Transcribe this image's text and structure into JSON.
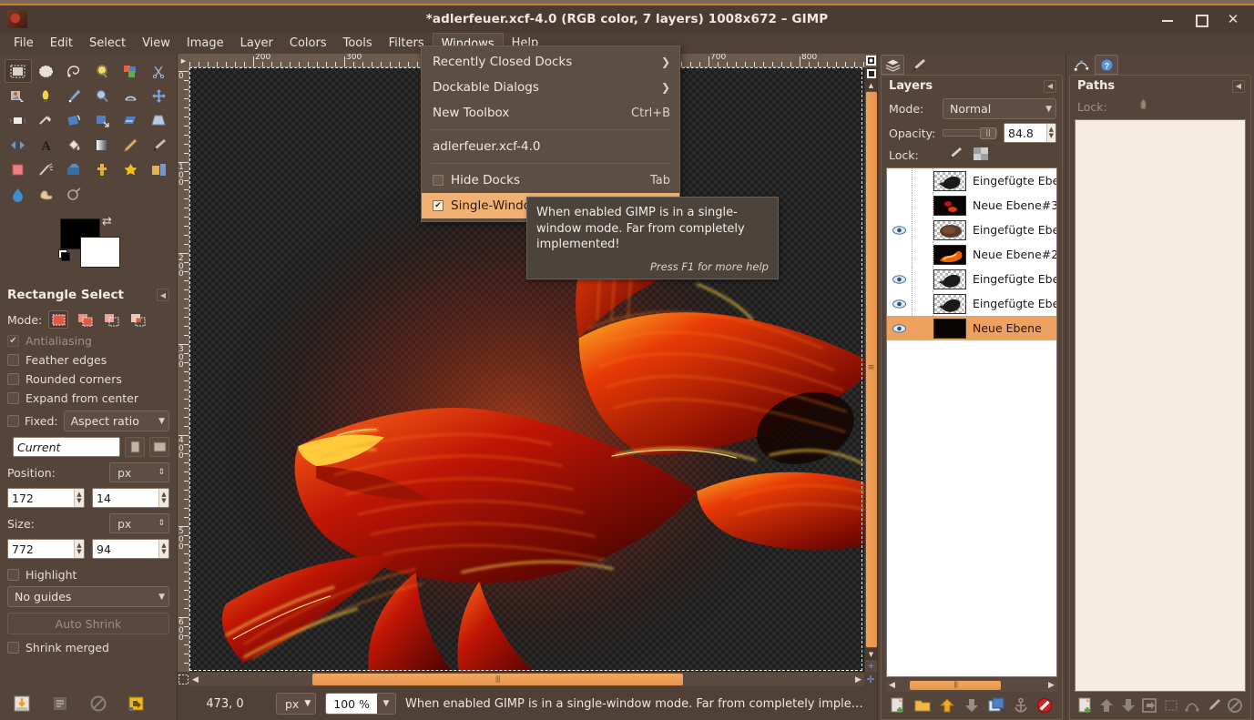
{
  "window": {
    "title": "*adlerfeuer.xcf-4.0 (RGB color, 7 layers) 1008x672 – GIMP",
    "app_icon": "gimp-wilber-icon",
    "minimize": "–",
    "maximize": "□",
    "close": "✕"
  },
  "menubar": [
    {
      "label": "File",
      "name": "menu-file"
    },
    {
      "label": "Edit",
      "name": "menu-edit"
    },
    {
      "label": "Select",
      "name": "menu-select"
    },
    {
      "label": "View",
      "name": "menu-view"
    },
    {
      "label": "Image",
      "name": "menu-image"
    },
    {
      "label": "Layer",
      "name": "menu-layer"
    },
    {
      "label": "Colors",
      "name": "menu-colors"
    },
    {
      "label": "Tools",
      "name": "menu-tools"
    },
    {
      "label": "Filters",
      "name": "menu-filters"
    },
    {
      "label": "Windows",
      "name": "menu-windows",
      "active": true
    },
    {
      "label": "Help",
      "name": "menu-help"
    }
  ],
  "windows_menu": {
    "items": [
      {
        "label": "Recently Closed Docks",
        "accel": "",
        "submenu": true,
        "type": "submenu"
      },
      {
        "label": "Dockable Dialogs",
        "accel": "",
        "submenu": true,
        "type": "submenu"
      },
      {
        "label": "New Toolbox",
        "accel": "Ctrl+B",
        "type": "normal"
      },
      {
        "type": "separator"
      },
      {
        "label": "adlerfeuer.xcf-4.0",
        "accel": "",
        "type": "normal"
      },
      {
        "type": "separator"
      },
      {
        "label": "Hide Docks",
        "accel": "Tab",
        "type": "check",
        "checked": false
      },
      {
        "label": "Single-Window Mode",
        "accel": "",
        "type": "check",
        "checked": true,
        "highlighted": true
      }
    ]
  },
  "tooltip": {
    "text": "When enabled GIMP is in a single-window mode. Far from completely implemented!",
    "help": "Press F1 for more help"
  },
  "toolbox": {
    "tools": [
      {
        "name": "rectangle-select-tool",
        "selected": true
      },
      {
        "name": "ellipse-select-tool"
      },
      {
        "name": "free-select-tool"
      },
      {
        "name": "fuzzy-select-tool"
      },
      {
        "name": "select-by-color-tool"
      },
      {
        "name": "scissors-select-tool"
      },
      {
        "name": "foreground-select-tool"
      },
      {
        "name": "paths-tool"
      },
      {
        "name": "color-picker-tool"
      },
      {
        "name": "zoom-tool"
      },
      {
        "name": "measure-tool"
      },
      {
        "name": "move-tool"
      },
      {
        "name": "alignment-tool"
      },
      {
        "name": "crop-tool"
      },
      {
        "name": "rotate-tool"
      },
      {
        "name": "scale-tool"
      },
      {
        "name": "shear-tool"
      },
      {
        "name": "perspective-tool"
      },
      {
        "name": "flip-tool"
      },
      {
        "name": "text-tool"
      },
      {
        "name": "bucket-fill-tool"
      },
      {
        "name": "blend-gradient-tool"
      },
      {
        "name": "pencil-tool"
      },
      {
        "name": "paintbrush-tool"
      },
      {
        "name": "eraser-tool"
      },
      {
        "name": "airbrush-tool"
      },
      {
        "name": "ink-tool"
      },
      {
        "name": "clone-tool"
      },
      {
        "name": "heal-tool"
      },
      {
        "name": "perspective-clone-tool"
      },
      {
        "name": "blur-sharpen-tool"
      },
      {
        "name": "smudge-tool"
      },
      {
        "name": "dodge-burn-tool"
      }
    ],
    "colors": {
      "foreground": "#000000",
      "background": "#ffffff"
    }
  },
  "tool_options": {
    "title": "Rectangle Select",
    "mode_label": "Mode:",
    "modes": [
      "replace",
      "add",
      "subtract",
      "intersect"
    ],
    "mode_selected": 0,
    "checkboxes": [
      {
        "label": "Antialiasing",
        "checked": true,
        "disabled": true
      },
      {
        "label": "Feather edges",
        "checked": false,
        "disabled": false
      },
      {
        "label": "Rounded corners",
        "checked": false,
        "disabled": false
      },
      {
        "label": "Expand from center",
        "checked": false,
        "disabled": false
      }
    ],
    "fixed_label": "Fixed:",
    "fixed_checked": false,
    "fixed_value": "Aspect ratio",
    "aspect_value": "Current",
    "position_label": "Position:",
    "position_unit": "px",
    "position_x": "172",
    "position_y": "14",
    "size_label": "Size:",
    "size_unit": "px",
    "size_w": "772",
    "size_h": "94",
    "highlight_label": "Highlight",
    "highlight_checked": false,
    "guides_value": "No guides",
    "auto_shrink_label": "Auto Shrink",
    "shrink_merged_label": "Shrink merged",
    "shrink_merged_checked": false,
    "footer_icons": [
      "save-tool-options-icon",
      "restore-tool-options-icon",
      "delete-tool-options-icon",
      "reset-tool-options-icon"
    ]
  },
  "canvas": {
    "h_ruler_labels": [
      "200",
      "300",
      "700",
      "800"
    ],
    "v_ruler_labels": [
      "0",
      "100",
      "200",
      "300",
      "400",
      "500",
      "600"
    ],
    "quickmask_icon": "quickmask-toggle-icon",
    "navigate_icon": "navigate-canvas-icon",
    "zoom_image_icon": "zoom-image-window-icon"
  },
  "statusbar": {
    "pointer_position": "473, 0",
    "unit": "px",
    "zoom": "100 %",
    "message": "When enabled GIMP is in a single-window mode. Far from completely imple…"
  },
  "layers_dock": {
    "tabs": [
      "layers-tab",
      "brushes-tab"
    ],
    "title": "Layers",
    "mode_label": "Mode:",
    "mode_value": "Normal",
    "opacity_label": "Opacity:",
    "opacity_value": "84.8",
    "lock_label": "Lock:",
    "lock_icons": [
      "lock-pixels-icon",
      "lock-alpha-icon"
    ],
    "layers": [
      {
        "name": "Eingefügte Ebe",
        "visible": false,
        "thumb": "transparent-eagle",
        "selected": false
      },
      {
        "name": "Neue Ebene#3",
        "visible": false,
        "thumb": "dark-flame",
        "selected": false
      },
      {
        "name": "Eingefügte Ebe",
        "visible": true,
        "thumb": "transparent-smoke",
        "selected": false
      },
      {
        "name": "Neue Ebene#2",
        "visible": false,
        "thumb": "dark-flame2",
        "selected": false
      },
      {
        "name": "Eingefügte Ebe",
        "visible": true,
        "thumb": "transparent-eagle",
        "selected": false
      },
      {
        "name": "Eingefügte Ebe",
        "visible": true,
        "thumb": "transparent-eagle",
        "selected": false
      },
      {
        "name": "Neue Ebene",
        "visible": true,
        "thumb": "black",
        "selected": true
      }
    ],
    "buttons": [
      "new-layer-icon",
      "new-layer-group-icon",
      "raise-layer-icon",
      "lower-layer-icon",
      "duplicate-layer-icon",
      "anchor-layer-icon",
      "delete-layer-icon"
    ]
  },
  "paths_dock": {
    "tabs": [
      "paths-tab",
      "help-tab"
    ],
    "title": "Paths",
    "lock_label": "Lock:",
    "lock_icons": [
      "lock-alpha-icon"
    ],
    "buttons": [
      "new-path-icon",
      "raise-path-icon",
      "lower-path-icon",
      "duplicate-path-icon",
      "path-to-selection-icon",
      "selection-to-path-icon",
      "stroke-path-icon",
      "delete-path-icon"
    ]
  },
  "colors": {
    "window_bg": "#4f4038",
    "panel_bg": "#54443a",
    "accent": "#eda260",
    "title_accent": "#c87f2e",
    "text": "#f0e8e0"
  }
}
